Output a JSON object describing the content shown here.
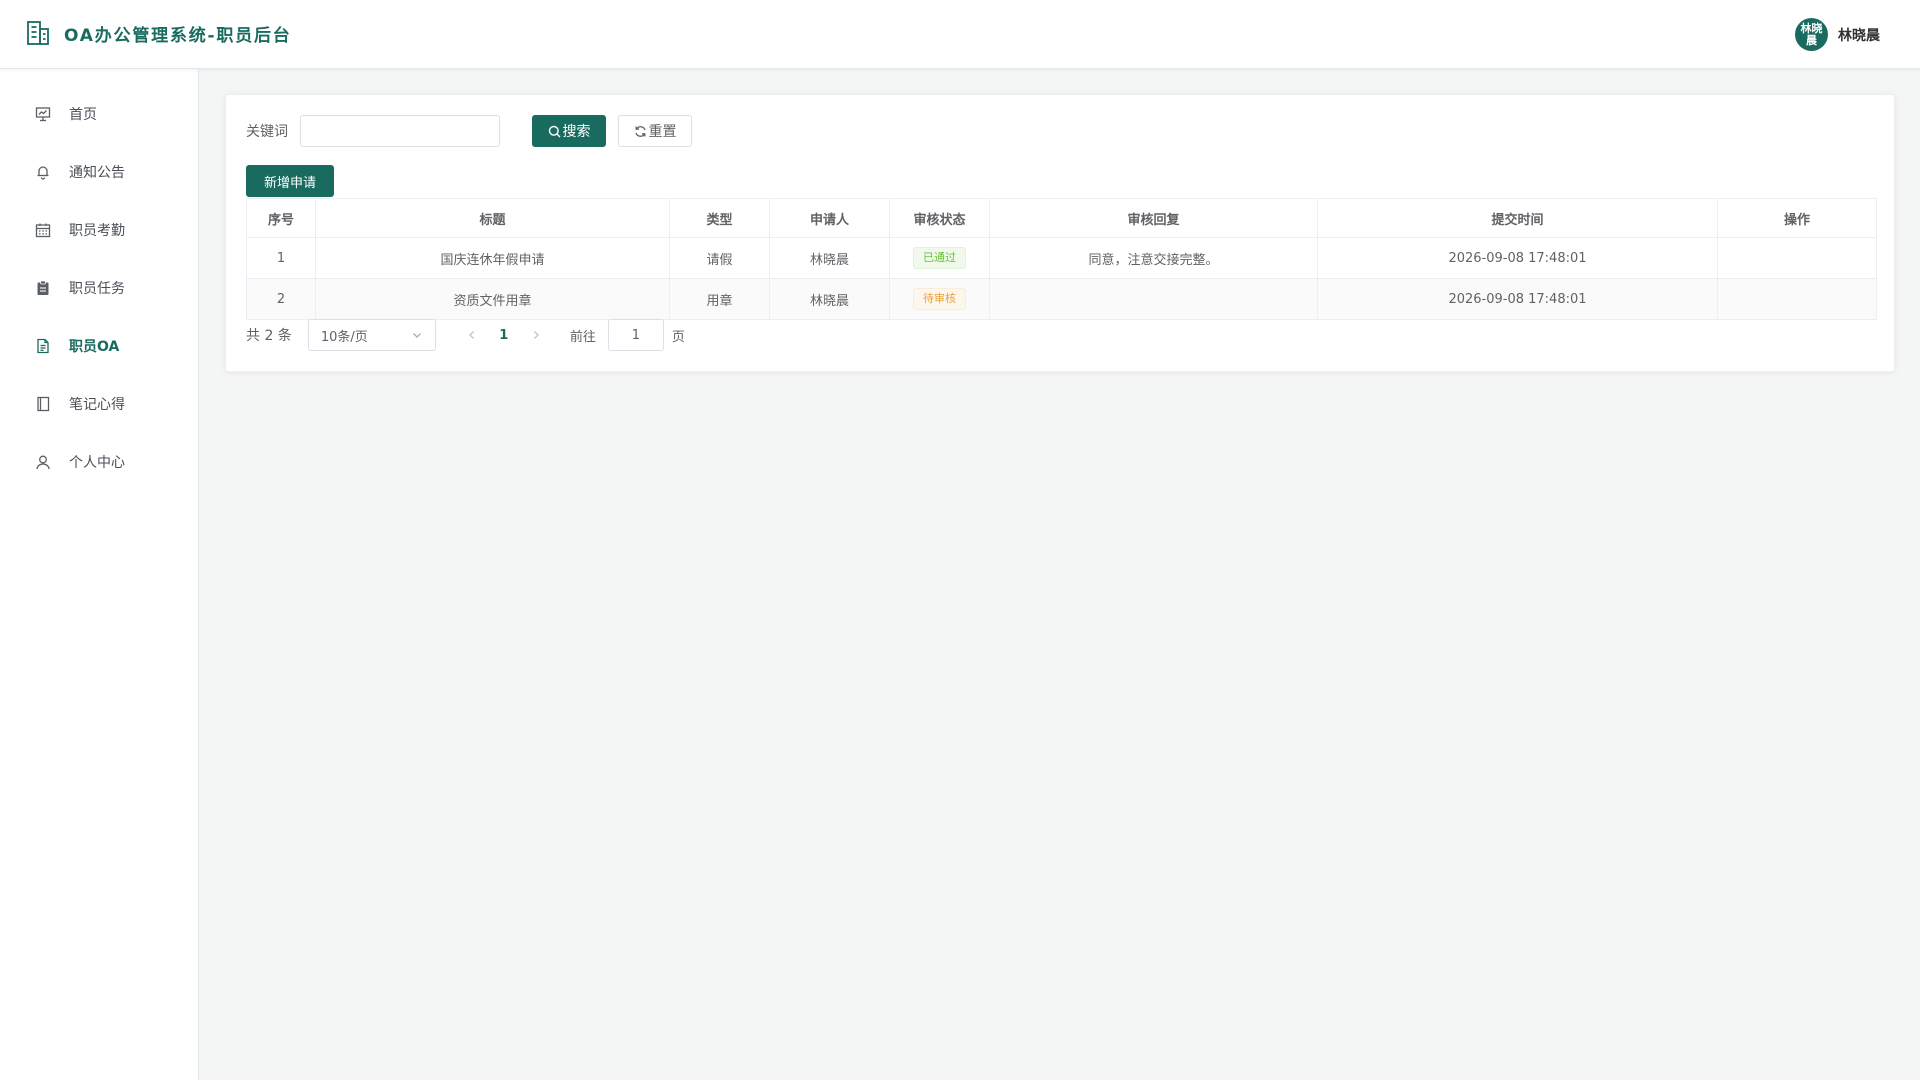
{
  "header": {
    "title": "OA办公管理系统-职员后台",
    "avatar_text": "林晓晨",
    "username": "林晓晨"
  },
  "sidebar": {
    "items": [
      {
        "label": "首页",
        "icon": "presentation-icon",
        "active": false
      },
      {
        "label": "通知公告",
        "icon": "bell-icon",
        "active": false
      },
      {
        "label": "职员考勤",
        "icon": "calendar-icon",
        "active": false
      },
      {
        "label": "职员任务",
        "icon": "clipboard-icon",
        "active": false
      },
      {
        "label": "职员OA",
        "icon": "document-icon",
        "active": true
      },
      {
        "label": "笔记心得",
        "icon": "notebook-icon",
        "active": false
      },
      {
        "label": "个人中心",
        "icon": "user-icon",
        "active": false
      }
    ]
  },
  "search": {
    "label": "关键词",
    "placeholder": "",
    "value": "",
    "search_button": "搜索",
    "reset_button": "重置"
  },
  "actions": {
    "add_button": "新增申请"
  },
  "table": {
    "headers": [
      "序号",
      "标题",
      "类型",
      "申请人",
      "审核状态",
      "审核回复",
      "提交时间",
      "操作"
    ],
    "rows": [
      {
        "index": "1",
        "title": "国庆连休年假申请",
        "type": "请假",
        "applicant": "林晓晨",
        "status": "已通过",
        "status_kind": "success",
        "reply": "同意，注意交接完整。",
        "submitted": "2026-09-08 17:48:01",
        "ops": ""
      },
      {
        "index": "2",
        "title": "资质文件用章",
        "type": "用章",
        "applicant": "林晓晨",
        "status": "待审核",
        "status_kind": "warning",
        "reply": "",
        "submitted": "2026-09-08 17:48:01",
        "ops": ""
      }
    ]
  },
  "pagination": {
    "total_text": "共 2 条",
    "page_size": "10条/页",
    "current_page": "1",
    "goto_label": "前往",
    "goto_value": "1",
    "page_suffix": "页"
  },
  "colors": {
    "brand": "#1a6b5f",
    "success": "#67c23a",
    "warning": "#e6a23c"
  }
}
